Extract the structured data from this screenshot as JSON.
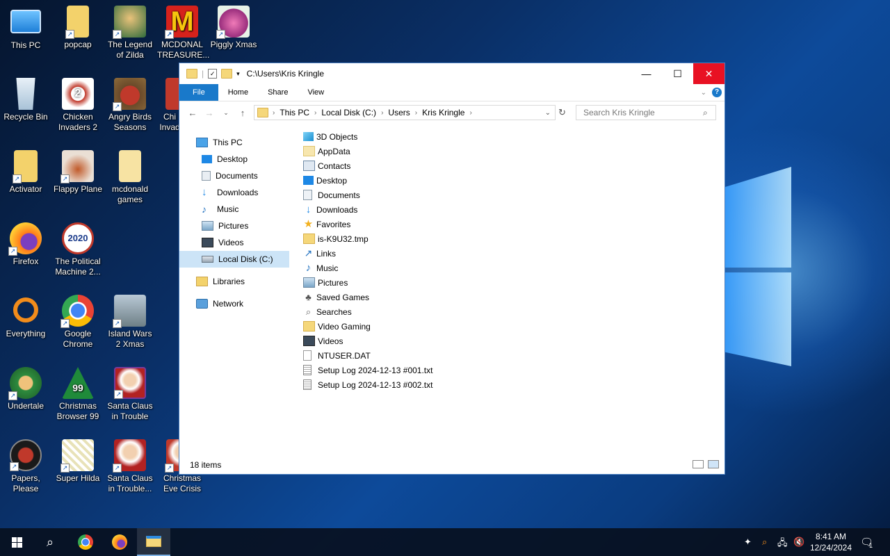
{
  "desktop": {
    "icons": [
      {
        "label": "This PC"
      },
      {
        "label": "popcap"
      },
      {
        "label": "The Legend of Zilda"
      },
      {
        "label": "MCDONAL TREASURE..."
      },
      {
        "label": "Piggly Xmas"
      },
      {
        "label": "Recycle Bin"
      },
      {
        "label": "Chicken Invaders 2"
      },
      {
        "label": "Angry Birds Seasons"
      },
      {
        "label": "Chi Invad"
      },
      {
        "label": "Activator"
      },
      {
        "label": "Flappy Plane"
      },
      {
        "label": "mcdonald games"
      },
      {
        "label": "Firefox"
      },
      {
        "label": "The Political Machine 2..."
      },
      {
        "label": "Everything"
      },
      {
        "label": "Google Chrome"
      },
      {
        "label": "Island Wars 2 Xmas"
      },
      {
        "label": "Undertale"
      },
      {
        "label": "Christmas Browser 99"
      },
      {
        "label": "Santa Claus in Trouble"
      },
      {
        "label": "Papers, Please"
      },
      {
        "label": "Super Hilda"
      },
      {
        "label": "Santa Claus in Trouble..."
      },
      {
        "label": "Christmas Eve Crisis"
      }
    ],
    "badges": {
      "chicken": "2",
      "political": "2020",
      "xmas99": "99"
    }
  },
  "explorer": {
    "title": "C:\\Users\\Kris Kringle",
    "window_controls": {
      "minimize": "—",
      "maximize": "☐",
      "close": "✕"
    },
    "ribbon_tabs": [
      "File",
      "Home",
      "Share",
      "View"
    ],
    "breadcrumb": [
      "This PC",
      "Local Disk (C:)",
      "Users",
      "Kris Kringle"
    ],
    "search_placeholder": "Search Kris Kringle",
    "nav_pane": [
      {
        "label": "This PC"
      },
      {
        "label": "Desktop"
      },
      {
        "label": "Documents"
      },
      {
        "label": "Downloads"
      },
      {
        "label": "Music"
      },
      {
        "label": "Pictures"
      },
      {
        "label": "Videos"
      },
      {
        "label": "Local Disk (C:)"
      },
      {
        "label": "Libraries"
      },
      {
        "label": "Network"
      }
    ],
    "files": [
      {
        "name": "3D Objects",
        "icon": "3d-objects-icon"
      },
      {
        "name": "AppData",
        "icon": "folder-icon"
      },
      {
        "name": "Contacts",
        "icon": "contacts-icon"
      },
      {
        "name": "Desktop",
        "icon": "desktop-icon"
      },
      {
        "name": "Documents",
        "icon": "documents-icon"
      },
      {
        "name": "Downloads",
        "icon": "downloads-icon"
      },
      {
        "name": "Favorites",
        "icon": "star-icon"
      },
      {
        "name": "is-K9U32.tmp",
        "icon": "folder-icon"
      },
      {
        "name": "Links",
        "icon": "link-icon"
      },
      {
        "name": "Music",
        "icon": "music-icon"
      },
      {
        "name": "Pictures",
        "icon": "pictures-icon"
      },
      {
        "name": "Saved Games",
        "icon": "saved-games-icon"
      },
      {
        "name": "Searches",
        "icon": "search-icon"
      },
      {
        "name": "Video Gaming",
        "icon": "folder-icon"
      },
      {
        "name": "Videos",
        "icon": "videos-icon"
      },
      {
        "name": "NTUSER.DAT",
        "icon": "file-icon"
      },
      {
        "name": "Setup Log 2024-12-13 #001.txt",
        "icon": "text-file-icon"
      },
      {
        "name": "Setup Log 2024-12-13 #002.txt",
        "icon": "text-file-icon"
      }
    ],
    "status": "18 items"
  },
  "taskbar": {
    "time": "8:41 AM",
    "date": "12/24/2024",
    "notification_count": "1"
  },
  "colors": {
    "accent": "#1979ca",
    "close_red": "#e81123",
    "folder": "#f5d77a"
  }
}
